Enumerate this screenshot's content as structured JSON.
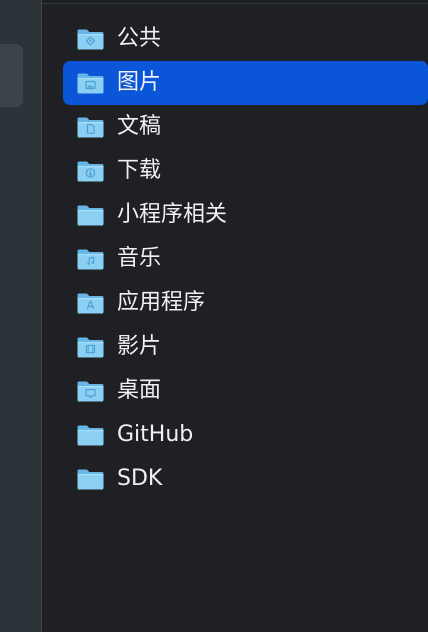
{
  "colors": {
    "selection": "#0b55d8",
    "folder_front": "#8bd0f2",
    "folder_back": "#66b7e7",
    "text": "#f0f1f2"
  },
  "items": [
    {
      "label": "公共",
      "icon": "public-folder-icon",
      "selected": false
    },
    {
      "label": "图片",
      "icon": "pictures-folder-icon",
      "selected": true
    },
    {
      "label": "文稿",
      "icon": "documents-folder-icon",
      "selected": false
    },
    {
      "label": "下载",
      "icon": "downloads-folder-icon",
      "selected": false
    },
    {
      "label": "小程序相关",
      "icon": "folder-icon",
      "selected": false
    },
    {
      "label": "音乐",
      "icon": "music-folder-icon",
      "selected": false
    },
    {
      "label": "应用程序",
      "icon": "applications-folder-icon",
      "selected": false
    },
    {
      "label": "影片",
      "icon": "movies-folder-icon",
      "selected": false
    },
    {
      "label": "桌面",
      "icon": "desktop-folder-icon",
      "selected": false
    },
    {
      "label": "GitHub",
      "icon": "folder-icon",
      "selected": false
    },
    {
      "label": "SDK",
      "icon": "folder-icon",
      "selected": false
    }
  ]
}
